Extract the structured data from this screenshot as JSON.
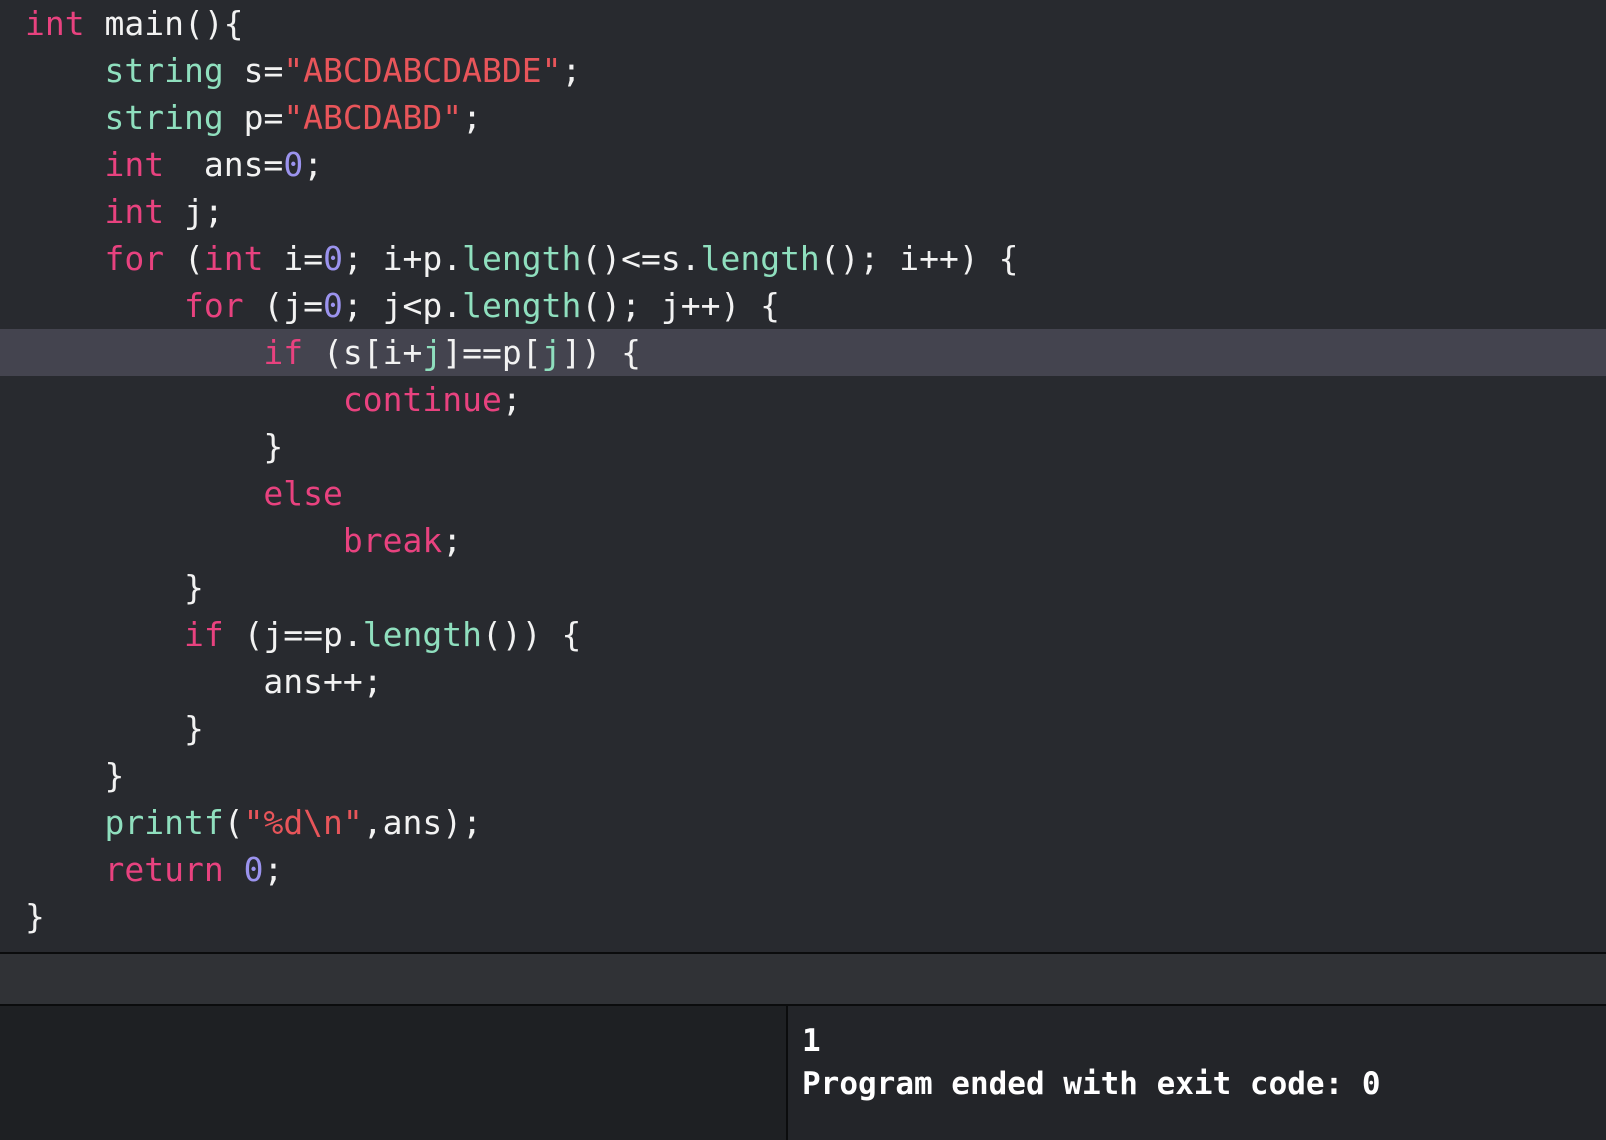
{
  "window": {
    "app": "code-editor",
    "theme_colors": {
      "editor_background": "#282a2f",
      "active_line_background": "#44444f",
      "console_background": "#1e2023",
      "output_background": "#232529",
      "toolbar_background": "#303236",
      "keyword": "#e8427f",
      "type": "#8fdfbe",
      "function": "#8fdfbe",
      "string": "#e8555a",
      "number": "#9b93ee",
      "plain_text": "#f2f2f2"
    }
  },
  "editor": {
    "language": "cpp",
    "active_line_index": 6,
    "lines": [
      {
        "index": 0,
        "tokens": [
          {
            "t": "int",
            "k": "kw"
          },
          {
            "t": " main(){",
            "k": "plain"
          }
        ]
      },
      {
        "index": 1,
        "tokens": [
          {
            "t": "    ",
            "k": "plain"
          },
          {
            "t": "string",
            "k": "type"
          },
          {
            "t": " s=",
            "k": "plain"
          },
          {
            "t": "\"ABCDABCDABDE\"",
            "k": "str"
          },
          {
            "t": ";",
            "k": "plain"
          }
        ]
      },
      {
        "index": 2,
        "tokens": [
          {
            "t": "    ",
            "k": "plain"
          },
          {
            "t": "string",
            "k": "type"
          },
          {
            "t": " p=",
            "k": "plain"
          },
          {
            "t": "\"ABCDABD\"",
            "k": "str"
          },
          {
            "t": ";",
            "k": "plain"
          }
        ]
      },
      {
        "index": 3,
        "tokens": [
          {
            "t": "    ",
            "k": "plain"
          },
          {
            "t": "int",
            "k": "kw"
          },
          {
            "t": "  ans=",
            "k": "plain"
          },
          {
            "t": "0",
            "k": "num"
          },
          {
            "t": ";",
            "k": "plain"
          }
        ]
      },
      {
        "index": 4,
        "tokens": [
          {
            "t": "    ",
            "k": "plain"
          },
          {
            "t": "int",
            "k": "kw"
          },
          {
            "t": " j;",
            "k": "plain"
          }
        ]
      },
      {
        "index": 5,
        "tokens": [
          {
            "t": "    ",
            "k": "plain"
          },
          {
            "t": "for",
            "k": "kw"
          },
          {
            "t": " (",
            "k": "plain"
          },
          {
            "t": "int",
            "k": "kw"
          },
          {
            "t": " i=",
            "k": "plain"
          },
          {
            "t": "0",
            "k": "num"
          },
          {
            "t": "; i+p.",
            "k": "plain"
          },
          {
            "t": "length",
            "k": "fn"
          },
          {
            "t": "()<=s.",
            "k": "plain"
          },
          {
            "t": "length",
            "k": "fn"
          },
          {
            "t": "(); i++) {",
            "k": "plain"
          }
        ]
      },
      {
        "index": 6,
        "tokens": [
          {
            "t": "        ",
            "k": "plain"
          },
          {
            "t": "for",
            "k": "kw"
          },
          {
            "t": " (j=",
            "k": "plain"
          },
          {
            "t": "0",
            "k": "num"
          },
          {
            "t": "; j<p.",
            "k": "plain"
          },
          {
            "t": "length",
            "k": "fn"
          },
          {
            "t": "(); j++) {",
            "k": "plain"
          }
        ]
      },
      {
        "index": 7,
        "active": true,
        "tokens": [
          {
            "t": "            ",
            "k": "plain"
          },
          {
            "t": "if",
            "k": "kw"
          },
          {
            "t": " (s[i+",
            "k": "plain"
          },
          {
            "t": "j",
            "k": "type"
          },
          {
            "t": "]==p[",
            "k": "plain"
          },
          {
            "t": "j",
            "k": "type"
          },
          {
            "t": "]) {",
            "k": "plain"
          }
        ]
      },
      {
        "index": 8,
        "tokens": [
          {
            "t": "                ",
            "k": "plain"
          },
          {
            "t": "continue",
            "k": "kw"
          },
          {
            "t": ";",
            "k": "plain"
          }
        ]
      },
      {
        "index": 9,
        "tokens": [
          {
            "t": "            }",
            "k": "plain"
          }
        ]
      },
      {
        "index": 10,
        "tokens": [
          {
            "t": "            ",
            "k": "plain"
          },
          {
            "t": "else",
            "k": "kw"
          }
        ]
      },
      {
        "index": 11,
        "tokens": [
          {
            "t": "                ",
            "k": "plain"
          },
          {
            "t": "break",
            "k": "kw"
          },
          {
            "t": ";",
            "k": "plain"
          }
        ]
      },
      {
        "index": 12,
        "tokens": [
          {
            "t": "        }",
            "k": "plain"
          }
        ]
      },
      {
        "index": 13,
        "tokens": [
          {
            "t": "        ",
            "k": "plain"
          },
          {
            "t": "if",
            "k": "kw"
          },
          {
            "t": " (j==p.",
            "k": "plain"
          },
          {
            "t": "length",
            "k": "fn"
          },
          {
            "t": "()) {",
            "k": "plain"
          }
        ]
      },
      {
        "index": 14,
        "tokens": [
          {
            "t": "            ans++;",
            "k": "plain"
          }
        ]
      },
      {
        "index": 15,
        "tokens": [
          {
            "t": "        }",
            "k": "plain"
          }
        ]
      },
      {
        "index": 16,
        "tokens": [
          {
            "t": "    }",
            "k": "plain"
          }
        ]
      },
      {
        "index": 17,
        "tokens": [
          {
            "t": "    ",
            "k": "plain"
          },
          {
            "t": "printf",
            "k": "fn"
          },
          {
            "t": "(",
            "k": "plain"
          },
          {
            "t": "\"%d\\n\"",
            "k": "str"
          },
          {
            "t": ",ans);",
            "k": "plain"
          }
        ]
      },
      {
        "index": 18,
        "tokens": [
          {
            "t": "    ",
            "k": "plain"
          },
          {
            "t": "return",
            "k": "kw"
          },
          {
            "t": " ",
            "k": "plain"
          },
          {
            "t": "0",
            "k": "num"
          },
          {
            "t": ";",
            "k": "plain"
          }
        ]
      },
      {
        "index": 19,
        "tokens": [
          {
            "t": "}",
            "k": "plain"
          }
        ]
      }
    ]
  },
  "toolbar": {
    "items": []
  },
  "console": {
    "debug_pane": {
      "content": ""
    },
    "output_pane": {
      "lines": [
        "1",
        "Program ended with exit code: 0"
      ]
    }
  }
}
